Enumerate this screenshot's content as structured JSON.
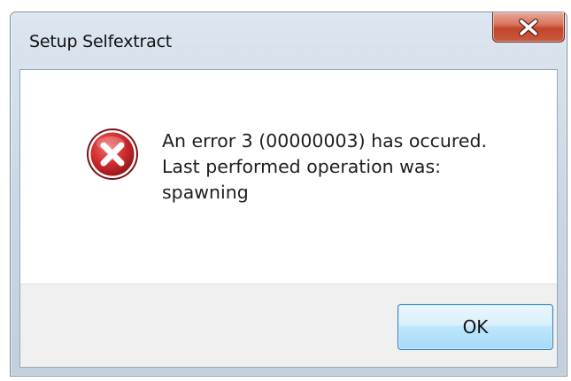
{
  "window": {
    "title": "Setup Selfextract",
    "close_glyph": "X"
  },
  "dialog": {
    "icon": "error-icon",
    "message": "An error 3 (00000003) has occured.\nLast performed operation was:\nspawning",
    "ok_label": "OK"
  },
  "colors": {
    "close_button": "#c2452a",
    "error_icon": "#c8262c",
    "ok_border": "#3c7fb1"
  }
}
